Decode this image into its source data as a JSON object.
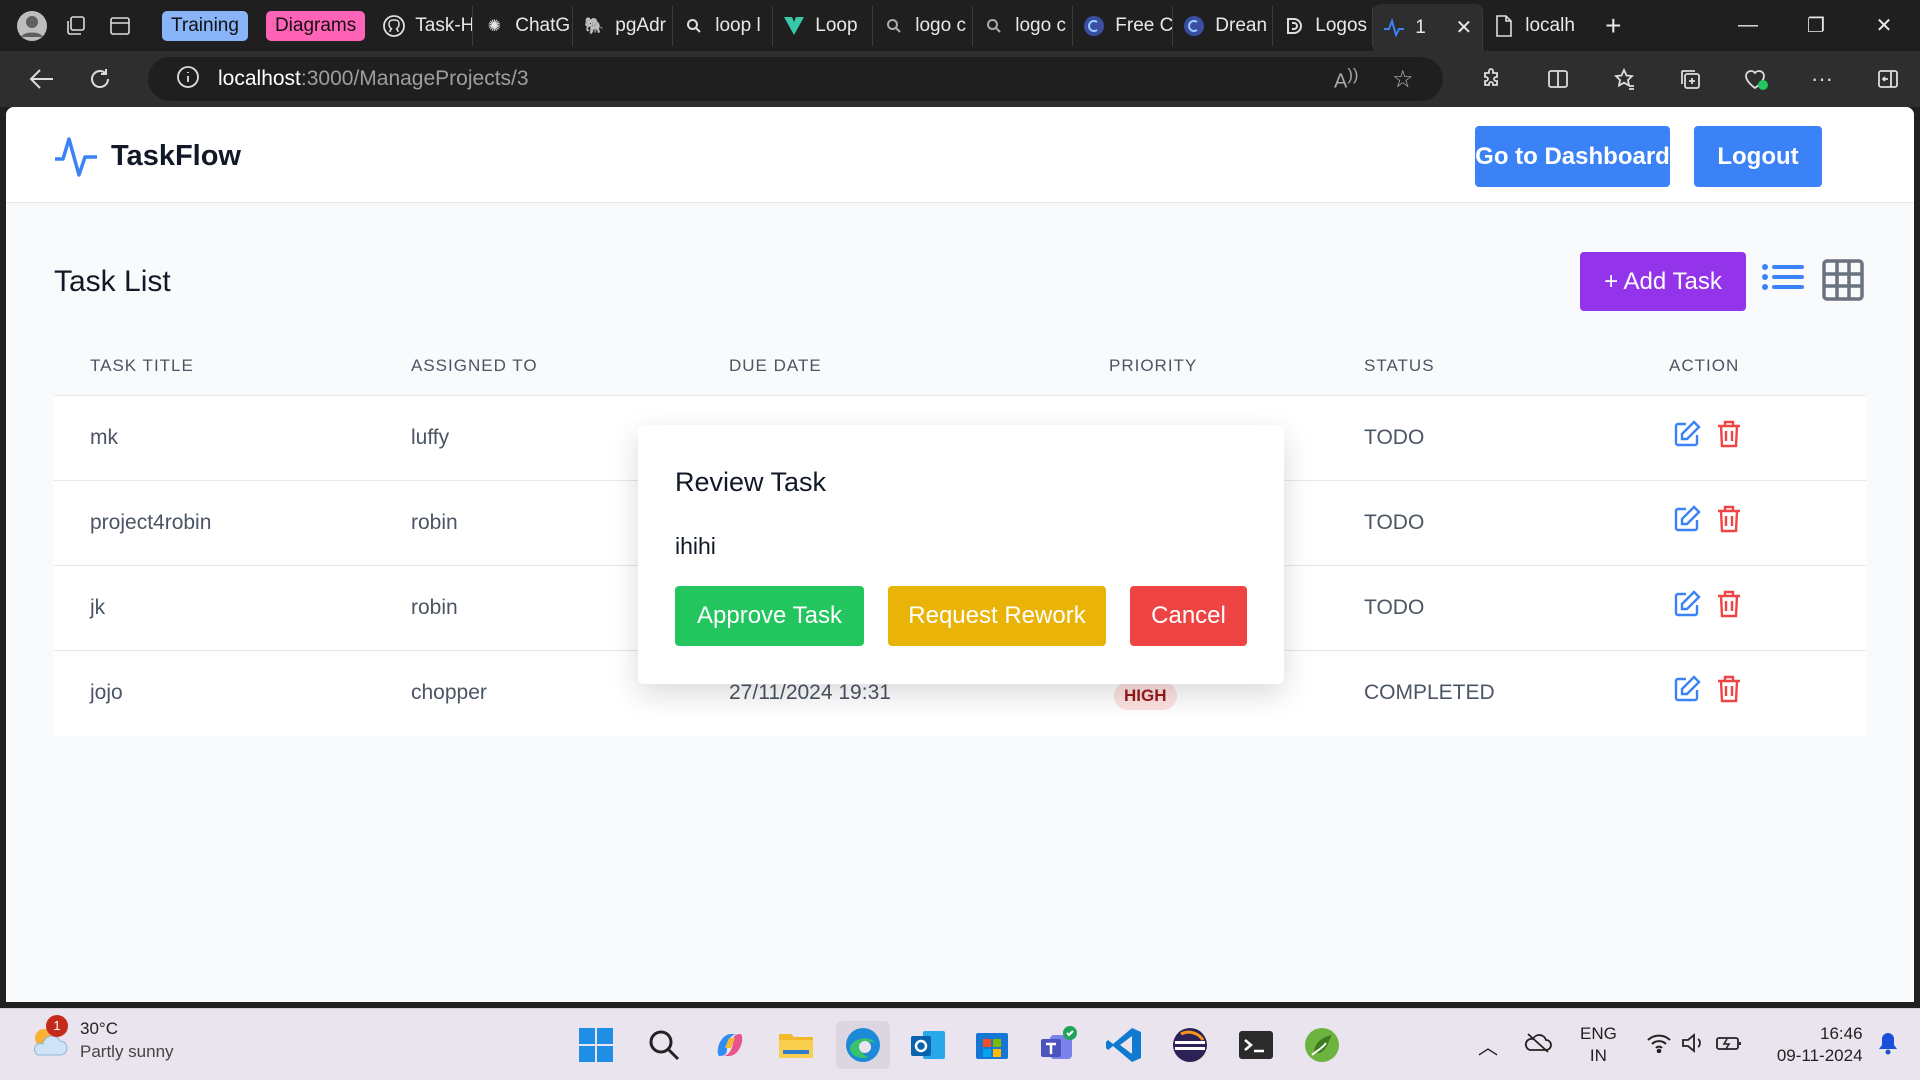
{
  "browser": {
    "tab_groups": [
      {
        "label": "Training",
        "color": "#8ab4f8"
      },
      {
        "label": "Diagrams",
        "color": "#ff63b8"
      }
    ],
    "tabs": [
      {
        "label": "Task-H",
        "icon": "github-icon"
      },
      {
        "label": "ChatG",
        "icon": "openai-icon"
      },
      {
        "label": "pgAdr",
        "icon": "elephant-icon"
      },
      {
        "label": "loop l",
        "icon": "search-icon"
      },
      {
        "label": "Loop",
        "icon": "vuetify-icon"
      },
      {
        "label": "logo c",
        "icon": "search-icon"
      },
      {
        "label": "logo c",
        "icon": "search-icon"
      },
      {
        "label": "Free C",
        "icon": "canva-icon"
      },
      {
        "label": "Drean",
        "icon": "canva-icon"
      },
      {
        "label": "Logos",
        "icon": "logos-icon"
      },
      {
        "label": "1",
        "icon": "pulse-icon",
        "active": true
      },
      {
        "label": "localh",
        "icon": "page-icon"
      }
    ],
    "url_host": "localhost",
    "url_path": ":3000/ManageProjects/3"
  },
  "app": {
    "brand": "TaskFlow",
    "brand_color": "#3b82f6",
    "header_buttons": {
      "dashboard": "Go to Dashboard",
      "logout": "Logout"
    },
    "page_title": "Task List",
    "add_task_label": "+ Add Task",
    "table": {
      "headers": [
        "Task Title",
        "Assigned To",
        "Due Date",
        "Priority",
        "Status",
        "Action"
      ],
      "rows": [
        {
          "title": "mk",
          "assigned": "luffy",
          "due": "",
          "priority": "",
          "status": "TODO"
        },
        {
          "title": "project4robin",
          "assigned": "robin",
          "due": "",
          "priority": "",
          "status": "TODO"
        },
        {
          "title": "jk",
          "assigned": "robin",
          "due": "",
          "priority": "",
          "status": "TODO"
        },
        {
          "title": "jojo",
          "assigned": "chopper",
          "due": "27/11/2024 19:31",
          "priority": "HIGH",
          "status": "COMPLETED"
        }
      ]
    },
    "modal": {
      "title": "Review Task",
      "body": "ihihi",
      "approve": "Approve Task",
      "rework": "Request Rework",
      "cancel": "Cancel",
      "colors": {
        "approve": "#22c55e",
        "rework": "#eab308",
        "cancel": "#ef4444"
      }
    }
  },
  "taskbar": {
    "weather_temp": "30°C",
    "weather_desc": "Partly sunny",
    "weather_badge": "1",
    "lang_top": "ENG",
    "lang_bottom": "IN",
    "time": "16:46",
    "date": "09-11-2024"
  }
}
